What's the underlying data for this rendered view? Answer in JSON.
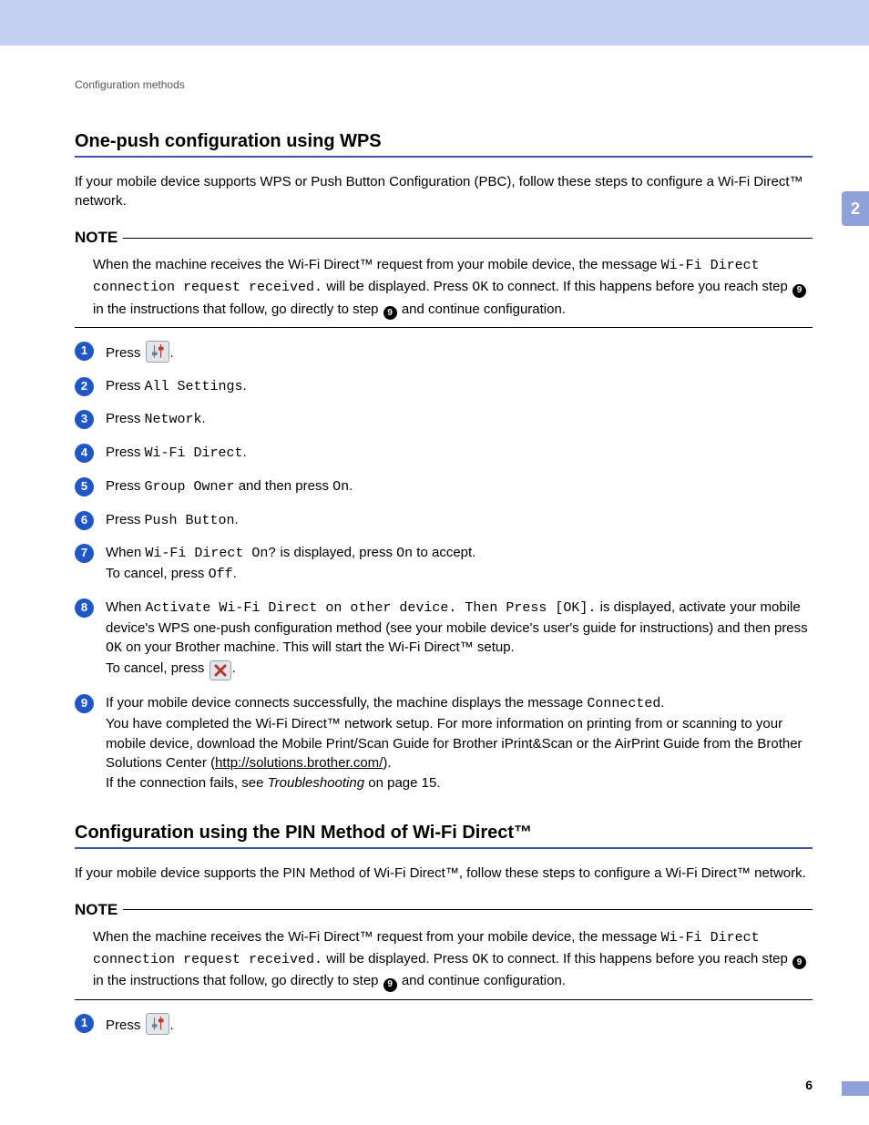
{
  "chapter_tab": "2",
  "running_head": "Configuration methods",
  "page_number": "6",
  "section1": {
    "heading": "One-push configuration using WPS",
    "intro": "If your mobile device supports WPS or Push Button Configuration (PBC), follow these steps to configure a Wi-Fi Direct™ network.",
    "note_label": "NOTE",
    "note": {
      "pre": "When the machine receives the Wi-Fi Direct™ request from your mobile device, the message ",
      "msg": "Wi-Fi Direct connection request received.",
      "mid1": " will be displayed. Press ",
      "ok": "OK",
      "mid2": " to connect. If this happens before you reach step ",
      "ref1": "9",
      "mid3": " in the instructions that follow, go directly to step ",
      "ref2": "9",
      "end": " and continue configuration."
    },
    "steps": {
      "s1_pre": "Press ",
      "s1_post": ".",
      "s2_pre": "Press ",
      "s2_code": "All Settings",
      "s2_post": ".",
      "s3_pre": "Press ",
      "s3_code": "Network",
      "s3_post": ".",
      "s4_pre": "Press ",
      "s4_code": "Wi-Fi Direct",
      "s4_post": ".",
      "s5_pre": "Press ",
      "s5_code1": "Group Owner",
      "s5_mid": " and then press ",
      "s5_code2": "On",
      "s5_post": ".",
      "s6_pre": "Press ",
      "s6_code": "Push Button",
      "s6_post": ".",
      "s7_pre": "When ",
      "s7_code1": "Wi-Fi Direct On?",
      "s7_mid1": " is displayed, press ",
      "s7_code2": "On",
      "s7_mid2": " to accept.",
      "s7_line2_pre": "To cancel, press ",
      "s7_line2_code": "Off",
      "s7_line2_post": ".",
      "s8_pre": "When ",
      "s8_code1": "Activate Wi-Fi Direct on other device. Then Press [OK].",
      "s8_mid1": " is displayed, activate your mobile device's WPS one-push configuration method (see your mobile device's user's guide for instructions) and then press ",
      "s8_code2": "OK",
      "s8_mid2": " on your Brother machine. This will start the Wi-Fi Direct™ setup.",
      "s8_line2_pre": "To cancel, press ",
      "s8_line2_post": ".",
      "s9_pre": "If your mobile device connects successfully, the machine displays the message ",
      "s9_code": "Connected",
      "s9_post": ".",
      "s9_line2_a": "You have completed the Wi-Fi Direct™ network setup. For more information on printing from or scanning to your mobile device, download the Mobile Print/Scan Guide for Brother iPrint&Scan or the AirPrint Guide from the Brother Solutions Center (",
      "s9_link": "http://solutions.brother.com/",
      "s9_line2_b": ").",
      "s9_line3_a": "If the connection fails, see ",
      "s9_line3_i": "Troubleshooting",
      "s9_line3_b": " on page 15."
    }
  },
  "section2": {
    "heading": "Configuration using the PIN Method of Wi-Fi Direct™",
    "intro": "If your mobile device supports the PIN Method of Wi-Fi Direct™, follow these steps to configure a Wi-Fi Direct™ network.",
    "note_label": "NOTE",
    "note": {
      "pre": "When the machine receives the Wi-Fi Direct™ request from your mobile device, the message ",
      "msg": "Wi-Fi Direct connection request received.",
      "mid1": " will be displayed. Press ",
      "ok": "OK",
      "mid2": " to connect. If this happens before you reach step ",
      "ref1": "9",
      "mid3": " in the instructions that follow, go directly to step ",
      "ref2": "9",
      "end": " and continue configuration."
    },
    "steps": {
      "s1_pre": "Press ",
      "s1_post": "."
    }
  }
}
